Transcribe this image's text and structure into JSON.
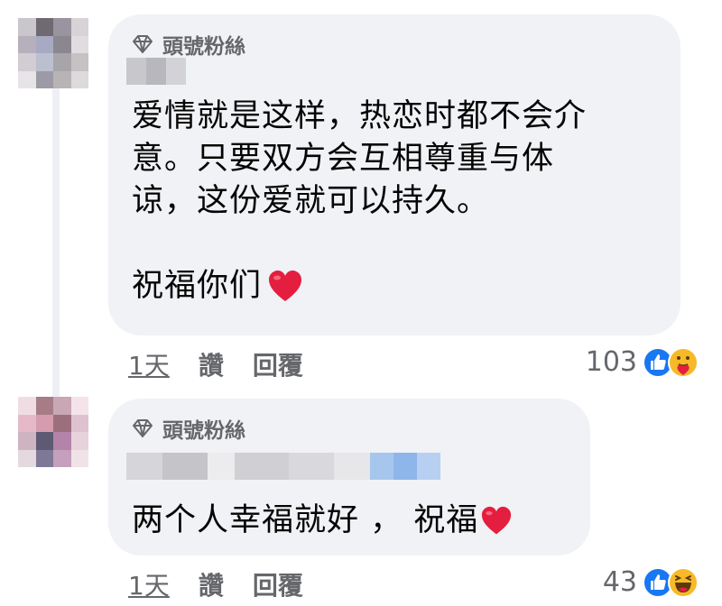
{
  "comments": [
    {
      "badge": "頭號粉絲",
      "text_lines": [
        "爱情就是这样，热恋时都不会介",
        "意。只要双方会互相尊重与体",
        "谅，这份爱就可以持久。",
        "",
        "祝福你们"
      ],
      "time": "1天",
      "like_label": "讚",
      "reply_label": "回覆",
      "reaction_count": "103",
      "reactions": [
        "like-icon",
        "care-icon"
      ]
    },
    {
      "badge": "頭號粉絲",
      "text_lines": [
        "两个人幸福就好 ， 祝福"
      ],
      "time": "1天",
      "like_label": "讚",
      "reply_label": "回覆",
      "reaction_count": "43",
      "reactions": [
        "like-icon",
        "haha-icon"
      ]
    }
  ],
  "colors": {
    "bubble": "#f0f2f5",
    "secondary_text": "#65676b",
    "like_blue": "#1877f2",
    "heart_red": "#e41e3f",
    "emoji_yellow": "#f7b928"
  }
}
